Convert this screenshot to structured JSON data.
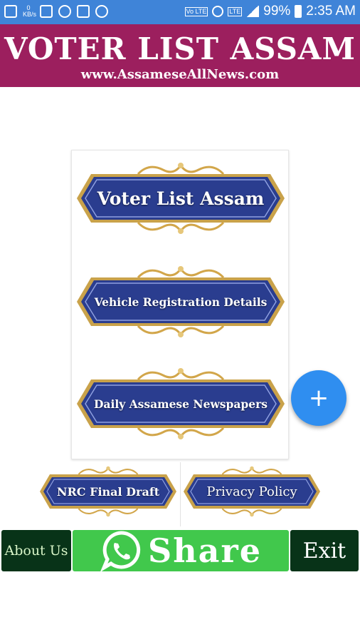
{
  "status_bar": {
    "net_speed_value": "0",
    "net_speed_unit": "KB/s",
    "battery_percent": "99%",
    "time": "2:35 AM",
    "volte_label": "Vo LTE",
    "lte_label": "LTE"
  },
  "header": {
    "title": "VOTER LIST ASSAM",
    "subtitle": "www.AssameseAllNews.com"
  },
  "menu": {
    "voter_list": "Voter List Assam",
    "vehicle_registration": "Vehicle Registration Details",
    "newspapers": "Daily Assamese Newspapers",
    "nrc_draft": "NRC Final Draft",
    "privacy_policy": "Privacy  Policy"
  },
  "fab": {
    "label": "+"
  },
  "bottom_bar": {
    "about": "About Us",
    "share": "Share",
    "exit": "Exit"
  },
  "colors": {
    "status_bar": "#3f84d8",
    "header_bg": "#9c1f5e",
    "plate_blue": "#2a3d8f",
    "gold": "#d2a64a",
    "fab": "#2f8ef0",
    "share_green": "#41c84c",
    "dark_green": "#083318"
  }
}
